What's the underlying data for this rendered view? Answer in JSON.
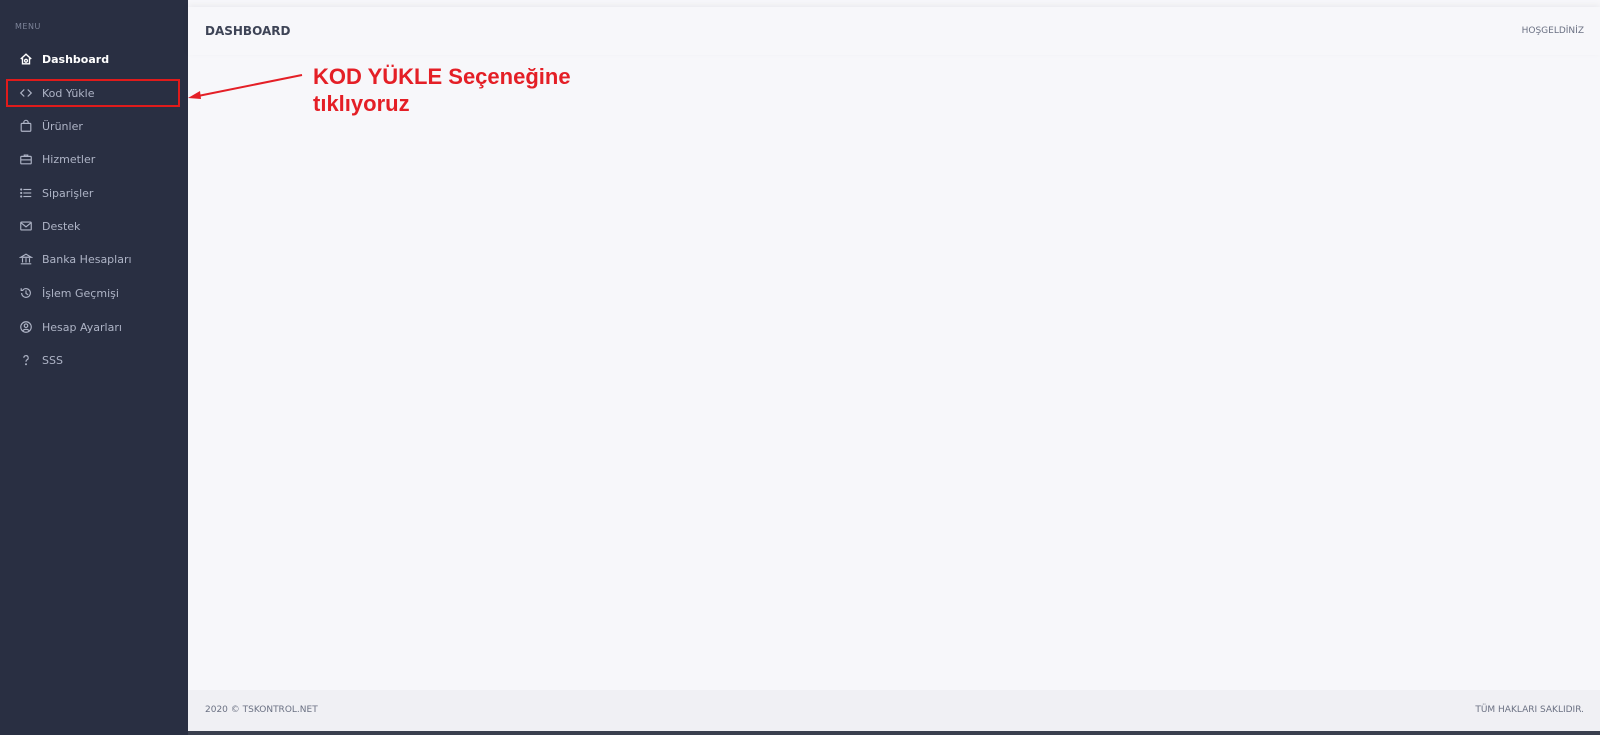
{
  "sidebar": {
    "menu_label": "MENU",
    "items": [
      {
        "label": "Dashboard",
        "icon": "home-icon"
      },
      {
        "label": "Kod Yükle",
        "icon": "code-icon"
      },
      {
        "label": "Ürünler",
        "icon": "bag-icon"
      },
      {
        "label": "Hizmetler",
        "icon": "briefcase-icon"
      },
      {
        "label": "Siparişler",
        "icon": "list-icon"
      },
      {
        "label": "Destek",
        "icon": "mail-icon"
      },
      {
        "label": "Banka Hesapları",
        "icon": "bank-icon"
      },
      {
        "label": "İşlem Geçmişi",
        "icon": "history-icon"
      },
      {
        "label": "Hesap Ayarları",
        "icon": "user-circle-icon"
      },
      {
        "label": "SSS",
        "icon": "question-icon"
      }
    ]
  },
  "header": {
    "title": "DASHBOARD",
    "welcome": "HOŞGELDİNİZ"
  },
  "annotation": {
    "line1": "KOD YÜKLE Seçeneğine",
    "line2": "tıklıyoruz",
    "color": "#e41f26"
  },
  "footer": {
    "left": "2020 © TSKONTROL.NET",
    "right": "TÜM HAKLARI SAKLIDIR."
  },
  "colors": {
    "sidebar_bg": "#292f42",
    "content_bg": "#f7f7fa",
    "highlight": "#e01b1b"
  }
}
